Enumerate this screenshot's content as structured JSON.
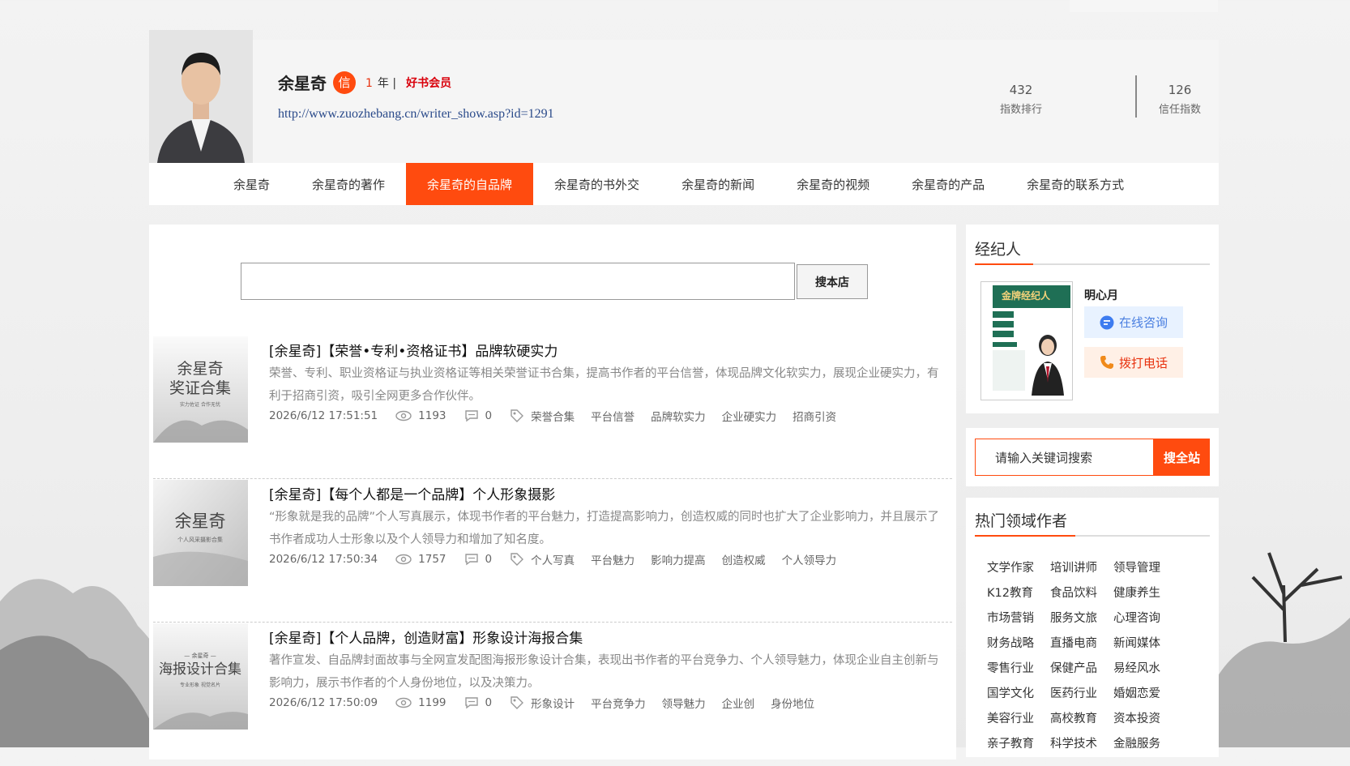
{
  "profile": {
    "name": "余星奇",
    "badge": "信",
    "years": "1",
    "years_suffix": "年 |",
    "vip": "好书会员",
    "url": "http://www.zuozhebang.cn/writer_show.asp?id=1291",
    "stats": [
      {
        "value": "432",
        "label": "指数排行"
      },
      {
        "value": "126",
        "label": "信任指数"
      }
    ]
  },
  "nav": {
    "items": [
      "余星奇",
      "余星奇的著作",
      "余星奇的自品牌",
      "余星奇的书外交",
      "余星奇的新闻",
      "余星奇的视频",
      "余星奇的产品",
      "余星奇的联系方式"
    ],
    "active_index": 2
  },
  "store_search": {
    "button": "搜本店",
    "value": ""
  },
  "articles": [
    {
      "thumb_lines": [
        "余星奇",
        "奖证合集",
        "实力佐证 合作无忧"
      ],
      "title": "[余星奇]【荣誉•专利•资格证书】品牌软硬实力",
      "desc": "荣誉、专利、职业资格证与执业资格证等相关荣誉证书合集，提高书作者的平台信誉，体现品牌文化软实力，展现企业硬实力，有利于招商引资，吸引全网更多合作伙伴。",
      "date": "2026/6/12 17:51:51",
      "views": "1193",
      "comments": "0",
      "tags": [
        "荣誉合集",
        "平台信誉",
        "品牌软实力",
        "企业硬实力",
        "招商引资"
      ]
    },
    {
      "thumb_lines": [
        "余星奇",
        "个人风采摄影合集"
      ],
      "title": "[余星奇]【每个人都是一个品牌】个人形象摄影",
      "desc": "“形象就是我的品牌”个人写真展示，体现书作者的平台魅力，打造提高影响力，创造权威的同时也扩大了企业影响力，并且展示了书作者成功人士形象以及个人领导力和增加了知名度。",
      "date": "2026/6/12 17:50:34",
      "views": "1757",
      "comments": "0",
      "tags": [
        "个人写真",
        "平台魅力",
        "影响力提高",
        "创造权威",
        "个人领导力"
      ]
    },
    {
      "thumb_lines": [
        "— 余星奇 —",
        "海报设计合集",
        "专业形象 视觉名片"
      ],
      "title": "[余星奇]【个人品牌，创造财富】形象设计海报合集",
      "desc": "著作宣发、自品牌封面故事与全网宣发配图海报形象设计合集，表现出书作者的平台竞争力、个人领导魅力，体现企业自主创新与影响力，展示书作者的个人身份地位，以及决策力。",
      "date": "2026/6/12 17:50:09",
      "views": "1199",
      "comments": "0",
      "tags": [
        "形象设计",
        "平台竞争力",
        "领导魅力",
        "企业创",
        "身份地位"
      ]
    }
  ],
  "agent": {
    "heading": "经纪人",
    "poster_title": "金牌经纪人",
    "name": "明心月",
    "consult": "在线咨询",
    "call": "拨打电话"
  },
  "site_search": {
    "placeholder": "请输入关键词搜索",
    "button": "搜全站"
  },
  "hot_authors": {
    "heading": "热门领域作者",
    "items": [
      "文学作家",
      "培训讲师",
      "领导管理",
      "K12教育",
      "食品饮料",
      "健康养生",
      "市场营销",
      "服务文旅",
      "心理咨询",
      "财务战略",
      "直播电商",
      "新闻媒体",
      "零售行业",
      "保健产品",
      "易经风水",
      "国学文化",
      "医药行业",
      "婚姻恋爱",
      "美容行业",
      "高校教育",
      "资本投资",
      "亲子教育",
      "科学技术",
      "金融服务"
    ]
  },
  "colors": {
    "accent": "#ff4b0f",
    "vip": "#d9000b",
    "link": "#2a4a8a"
  }
}
